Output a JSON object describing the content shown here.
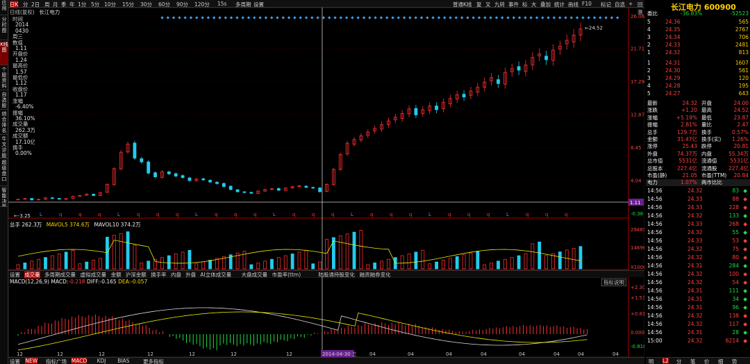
{
  "sidebar": [
    "应用",
    "分时图",
    "K线图",
    "个股资料",
    "自选股",
    "综合排名",
    "牛叉诊股",
    "超级盘口",
    "智能决策"
  ],
  "topbar": {
    "items": [
      "日K",
      "分",
      "2日",
      "周",
      "月",
      "季",
      "年",
      "1分",
      "5分",
      "10分",
      "15分",
      "30分",
      "60分",
      "90分",
      "120分",
      "15s",
      "多周期",
      "设置"
    ],
    "active": "日K",
    "right_items": [
      "普通K线",
      "复",
      "叉",
      "九转",
      "事件",
      "标",
      "大",
      "叠加",
      "统计",
      "画线",
      "F10",
      "标记",
      "自选",
      "+",
      "回测",
      "更多"
    ]
  },
  "chart_title": {
    "period": "日线(复权)",
    "name": "长江电力"
  },
  "info_panel": [
    {
      "label": "时间",
      "value": "2014"
    },
    {
      "label": "",
      "value": "0430"
    },
    {
      "label": "周三",
      "value": ""
    },
    {
      "label": "数值",
      "value": "1.11"
    },
    {
      "label": "开盘价",
      "value": "1.24"
    },
    {
      "label": "最高价",
      "value": "1.57"
    },
    {
      "label": "最低价",
      "value": "1.12"
    },
    {
      "label": "收盘价",
      "value": "1.17"
    },
    {
      "label": "涨幅",
      "value": "-6.40%"
    },
    {
      "label": "振幅",
      "value": "36.10%"
    },
    {
      "label": "成交量",
      "value": "262.3万"
    },
    {
      "label": "成交额",
      "value": "17.10亿"
    },
    {
      "label": "换手",
      "value": "0.00%"
    }
  ],
  "price_axis": [
    "26.06",
    "21.71",
    "17.29",
    "12.87",
    "8.45",
    "4.04",
    "1.11",
    "-0.38"
  ],
  "price_labels": {
    "high": "24.52",
    "low": "-3.25",
    "cursor": "1.11"
  },
  "volume_header": {
    "label": "总手",
    "total": "262.3万",
    "ma5_label": "MAVOL5",
    "ma5": "374.6万",
    "ma10_label": "MAVOL10",
    "ma10": "374.2万"
  },
  "volume_axis": [
    "29465",
    "14696",
    "X1000"
  ],
  "tabs": [
    "设置",
    "成交量",
    "多周期成交量",
    "虚拟成交量",
    "金额",
    "沪深金额",
    "换手率",
    "内盘",
    "外盘",
    "AI立体成交量",
    "大盘成交量",
    "市盈率(ttm)",
    "陆股通持股变化",
    "融资融券变化"
  ],
  "active_tab": "成交量",
  "macd_header": {
    "label": "MACD(12,26,9)",
    "macd": "-0.218",
    "diff": "-0.165",
    "dea": "-0.057",
    "explain": "指标说明"
  },
  "macd_axis": [
    "+2.30",
    "+1.53",
    "+0.813",
    "0.000",
    "-0.810"
  ],
  "date_axis": [
    "12",
    "12",
    "12",
    "12",
    "12",
    "12",
    "12",
    "2014-04-30 三",
    "04",
    "04",
    "04",
    "04",
    "04",
    "04",
    "04",
    "04"
  ],
  "bottom_tabs": [
    "设置",
    "NEW",
    "指标广场",
    "MACD",
    "KDJ",
    "BIAS",
    "更多指标"
  ],
  "bottom_active": "MACD",
  "quote": {
    "title": "长江电力 600900",
    "ratio_label": "委比",
    "ratio": "-36.83%",
    "diff": "-52523",
    "sells": [
      {
        "lv": "5",
        "p": "24.36",
        "v": "565"
      },
      {
        "lv": "4",
        "p": "24.35",
        "v": "2767"
      },
      {
        "lv": "3",
        "p": "24.34",
        "v": "706"
      },
      {
        "lv": "2",
        "p": "24.33",
        "v": "2481"
      },
      {
        "lv": "1",
        "p": "24.32",
        "v": "813"
      }
    ],
    "buys": [
      {
        "lv": "1",
        "p": "24.31",
        "v": "1607"
      },
      {
        "lv": "2",
        "p": "24.30",
        "v": "561"
      },
      {
        "lv": "3",
        "p": "24.29",
        "v": "120"
      },
      {
        "lv": "4",
        "p": "24.28",
        "v": "195"
      },
      {
        "lv": "5",
        "p": "24.27",
        "v": "643"
      }
    ],
    "stats": [
      [
        "最新",
        "24.32",
        "开盘",
        "24.00"
      ],
      [
        "涨跌",
        "+1.20",
        "最高",
        "24.52"
      ],
      [
        "涨幅",
        "+5.19%",
        "最低",
        "23.87"
      ],
      [
        "振幅",
        "2.81%",
        "量比",
        "2.47"
      ],
      [
        "总手",
        "129.7万",
        "换手",
        "0.57%"
      ],
      [
        "金额",
        "31.47亿",
        "换手(实)",
        "1.26%"
      ],
      [
        "涨停",
        "25.43",
        "跌停",
        "20.81"
      ],
      [
        "外盘",
        "74.37万",
        "内盘",
        "55.34万"
      ],
      [
        "总市值",
        "5531亿",
        "流通值",
        "5531亿"
      ],
      [
        "总股本",
        "227.4亿",
        "流通股",
        "227.4亿"
      ],
      [
        "市盈(静)",
        "21.05",
        "市盈(TTM)",
        "20.84"
      ]
    ],
    "sector_bar": {
      "name": "电力",
      "pct": "1.07%",
      "extra": "两市比比"
    },
    "ticks": [
      [
        "14:56",
        "24.32",
        "83"
      ],
      [
        "14:56",
        "24.33",
        "88"
      ],
      [
        "14:56",
        "24.33",
        "228"
      ],
      [
        "14:56",
        "24.32",
        "133"
      ],
      [
        "14:56",
        "24.33",
        "268"
      ],
      [
        "14:56",
        "24.32",
        "55"
      ],
      [
        "14:56",
        "24.33",
        "53"
      ],
      [
        "14:56",
        "24.32",
        "75"
      ],
      [
        "14:56",
        "24.32",
        "80"
      ],
      [
        "14:56",
        "24.31",
        "284"
      ],
      [
        "14:56",
        "24.32",
        "100"
      ],
      [
        "14:56",
        "24.32",
        "54"
      ],
      [
        "14:56",
        "24.31",
        "111"
      ],
      [
        "14:56",
        "24.31",
        "34"
      ],
      [
        "14:56",
        "24.31",
        "96"
      ],
      [
        "14:56",
        "24.32",
        "138"
      ],
      [
        "14:56",
        "24.32",
        "117"
      ],
      [
        "14:56",
        "24.31",
        "28"
      ],
      [
        "15:00",
        "24.32",
        "6214"
      ]
    ],
    "tick_dirs": [
      "b",
      "s",
      "s",
      "b",
      "s",
      "b",
      "s",
      "s",
      "s",
      "b",
      "s",
      "s",
      "b",
      "b",
      "b",
      "s",
      "s",
      "b",
      "s"
    ],
    "footer": [
      "明",
      "L2",
      "分",
      "笔",
      "价",
      "细",
      "势"
    ]
  },
  "chart_data": {
    "type": "candlestick",
    "ylim": [
      -0.38,
      26.06
    ],
    "note_points": [
      1.5,
      1.6,
      1.4,
      1.5,
      1.7,
      1.6,
      1.5,
      1.6,
      1.9,
      2.0,
      2.2,
      2.0,
      2.4,
      3.5,
      5.6,
      7.8,
      8.9,
      7.0,
      6.5,
      5.0,
      4.5,
      5.2,
      4.9,
      4.6,
      4.4,
      4.0,
      4.2,
      4.1,
      3.8,
      3.6,
      3.2,
      2.8,
      2.5,
      2.4,
      2.3,
      2.6,
      2.8,
      2.9,
      2.7,
      3.0,
      3.2,
      3.3,
      3.1,
      3.0,
      2.5,
      3.5,
      5.5,
      7.5,
      9.0,
      9.5,
      10.0,
      10.5,
      11.0,
      11.5,
      12.0,
      12.5,
      13.0,
      13.6,
      12.8,
      13.5,
      14.0,
      13.5,
      14.5,
      15.0,
      15.5,
      15.2,
      16.0,
      16.5,
      17.2,
      17.8,
      17.0,
      18.5,
      19.0,
      18.8,
      19.5,
      20.5,
      21.0,
      20.2,
      21.5,
      22.0,
      22.8,
      23.5,
      24.32
    ]
  }
}
